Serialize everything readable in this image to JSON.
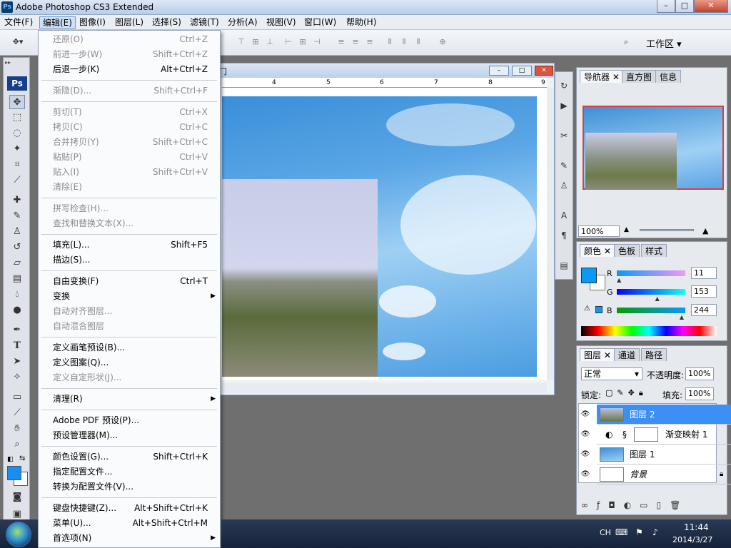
{
  "window": {
    "title": "Adobe Photoshop CS3 Extended",
    "app_icon": "Ps",
    "minimize": "–",
    "maximize": "□",
    "close": "✕"
  },
  "menubar": [
    "文件(F)",
    "编辑(E)",
    "图像(I)",
    "图层(L)",
    "选择(S)",
    "滤镜(T)",
    "分析(A)",
    "视图(V)",
    "窗口(W)",
    "帮助(H)"
  ],
  "optionsbar": {
    "workspace_label": "工作区 ▾"
  },
  "toolbox": {
    "logo": "Ps",
    "fg_color": "#1a8ef0",
    "bg_color": "#ffffff"
  },
  "edit_menu": {
    "items": [
      {
        "label": "还原(O)",
        "shortcut": "Ctrl+Z",
        "disabled": true
      },
      {
        "label": "前进一步(W)",
        "shortcut": "Shift+Ctrl+Z",
        "disabled": true
      },
      {
        "label": "后退一步(K)",
        "shortcut": "Alt+Ctrl+Z",
        "disabled": false
      },
      {
        "sep": true
      },
      {
        "label": "渐隐(D)...",
        "shortcut": "Shift+Ctrl+F",
        "disabled": true
      },
      {
        "sep": true
      },
      {
        "label": "剪切(T)",
        "shortcut": "Ctrl+X",
        "disabled": true
      },
      {
        "label": "拷贝(C)",
        "shortcut": "Ctrl+C",
        "disabled": true
      },
      {
        "label": "合并拷贝(Y)",
        "shortcut": "Shift+Ctrl+C",
        "disabled": true
      },
      {
        "label": "粘贴(P)",
        "shortcut": "Ctrl+V",
        "disabled": true
      },
      {
        "label": "贴入(I)",
        "shortcut": "Shift+Ctrl+V",
        "disabled": true
      },
      {
        "label": "清除(E)",
        "shortcut": "",
        "disabled": true
      },
      {
        "sep": true
      },
      {
        "label": "拼写检查(H)...",
        "shortcut": "",
        "disabled": true
      },
      {
        "label": "查找和替换文本(X)...",
        "shortcut": "",
        "disabled": true
      },
      {
        "sep": true
      },
      {
        "label": "填充(L)...",
        "shortcut": "Shift+F5",
        "disabled": false
      },
      {
        "label": "描边(S)...",
        "shortcut": "",
        "disabled": false
      },
      {
        "sep": true
      },
      {
        "label": "自由变换(F)",
        "shortcut": "Ctrl+T",
        "disabled": false
      },
      {
        "label": "变换",
        "shortcut": "",
        "disabled": false,
        "submenu": true
      },
      {
        "label": "自动对齐图层...",
        "shortcut": "",
        "disabled": true
      },
      {
        "label": "自动混合图层",
        "shortcut": "",
        "disabled": true
      },
      {
        "sep": true
      },
      {
        "label": "定义画笔预设(B)...",
        "shortcut": "",
        "disabled": false
      },
      {
        "label": "定义图案(Q)...",
        "shortcut": "",
        "disabled": false
      },
      {
        "label": "定义自定形状(J)...",
        "shortcut": "",
        "disabled": true
      },
      {
        "sep": true
      },
      {
        "label": "清理(R)",
        "shortcut": "",
        "disabled": false,
        "submenu": true
      },
      {
        "sep": true
      },
      {
        "label": "Adobe PDF 预设(P)...",
        "shortcut": "",
        "disabled": false
      },
      {
        "label": "预设管理器(M)...",
        "shortcut": "",
        "disabled": false
      },
      {
        "sep": true
      },
      {
        "label": "颜色设置(G)...",
        "shortcut": "Shift+Ctrl+K",
        "disabled": false
      },
      {
        "label": "指定配置文件...",
        "shortcut": "",
        "disabled": false
      },
      {
        "label": "转换为配置文件(V)...",
        "shortcut": "",
        "disabled": false
      },
      {
        "sep": true
      },
      {
        "label": "键盘快捷键(Z)...",
        "shortcut": "Alt+Shift+Ctrl+K",
        "disabled": false
      },
      {
        "label": "菜单(U)...",
        "shortcut": "Alt+Shift+Ctrl+M",
        "disabled": false
      },
      {
        "label": "首选项(N)",
        "shortcut": "",
        "disabled": false,
        "submenu": true
      }
    ]
  },
  "document": {
    "title_fragment": "门",
    "ruler_ticks": [
      "4",
      "5",
      "6",
      "7",
      "8",
      "9"
    ]
  },
  "navigator": {
    "tabs": [
      "导航器 ✕",
      "直方图",
      "信息"
    ],
    "zoom": "100%"
  },
  "color_panel": {
    "tabs": [
      "颜色 ✕",
      "色板",
      "样式"
    ],
    "r_label": "R",
    "g_label": "G",
    "b_label": "B",
    "r_value": "11",
    "g_value": "153",
    "b_value": "244",
    "r_level": 0.043,
    "g_level": 0.6,
    "b_level": 0.957,
    "swatch": "#0b99f4"
  },
  "layers_panel": {
    "tabs": [
      "图层 ✕",
      "通道",
      "路径"
    ],
    "blend_mode": "正常",
    "opacity_label": "不透明度:",
    "opacity_value": "100%",
    "lock_label": "锁定:",
    "fill_label": "填充:",
    "fill_value": "100%",
    "layers": [
      {
        "name": "图层 2",
        "selected": true
      },
      {
        "name": "渐变映射 1",
        "selected": false
      },
      {
        "name": "图层 1",
        "selected": false
      },
      {
        "name": "背景",
        "selected": false
      }
    ]
  },
  "taskbar": {
    "lang": "CH",
    "time": "11:44",
    "date": "2014/3/27"
  }
}
